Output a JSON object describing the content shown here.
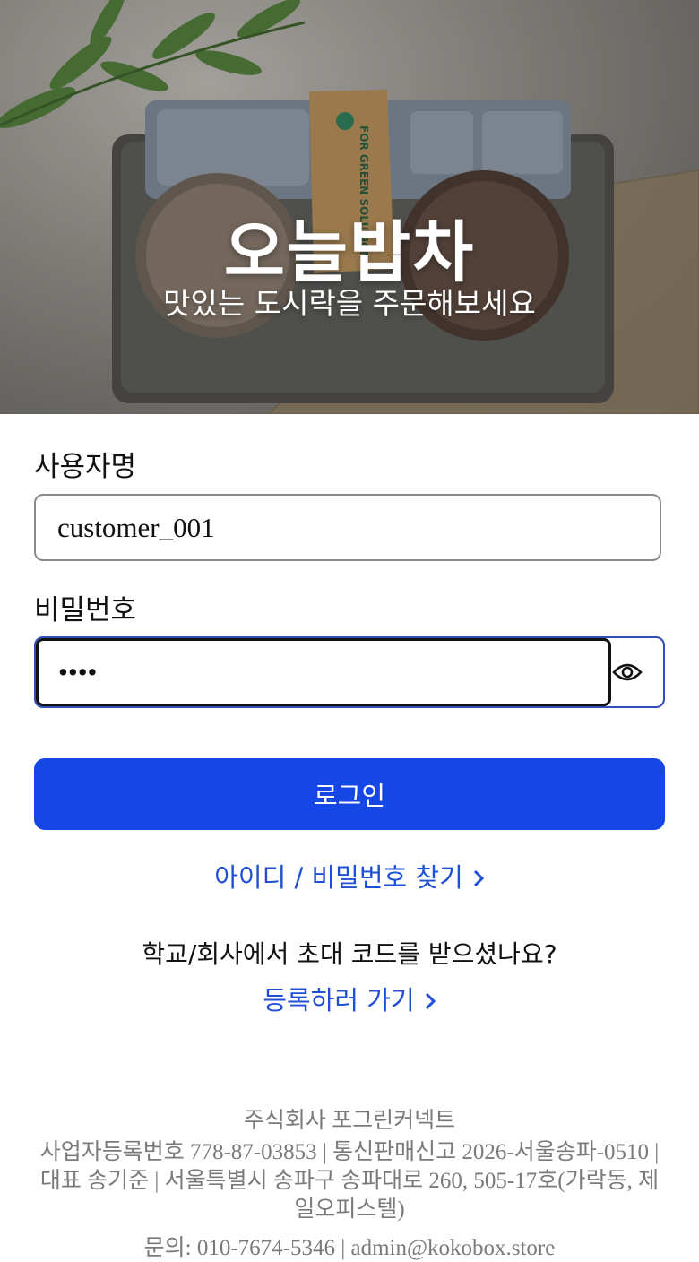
{
  "hero": {
    "title": "오늘밥차",
    "subtitle": "맛있는 도시락을 주문해보세요",
    "package_label": "FOR GREEN SOLUTION"
  },
  "form": {
    "username": {
      "label": "사용자명",
      "value": "customer_001"
    },
    "password": {
      "label": "비밀번호",
      "value": "••••",
      "toggle_icon": "eye-icon"
    },
    "login_label": "로그인",
    "find_link": "아이디 / 비밀번호 찾기",
    "invite_question": "학교/회사에서 초대 코드를 받으셨나요?",
    "register_link": "등록하러 가기"
  },
  "footer": {
    "company": "주식회사 포그린커넥트",
    "info": "사업자등록번호 778-87-03853 | 통신판매신고 2026-서울송파-0510 | 대표 송기준 | 서울특별시 송파구 송파대로 260, 505-17호(가락동, 제일오피스텔)",
    "contact": "문의: 010-7674-5346 | admin@kokobox.store"
  },
  "colors": {
    "primary": "#1546e6",
    "link": "#1f4fd6",
    "focus_border": "#2f4fb8",
    "footer_text": "#7a7a7a"
  }
}
